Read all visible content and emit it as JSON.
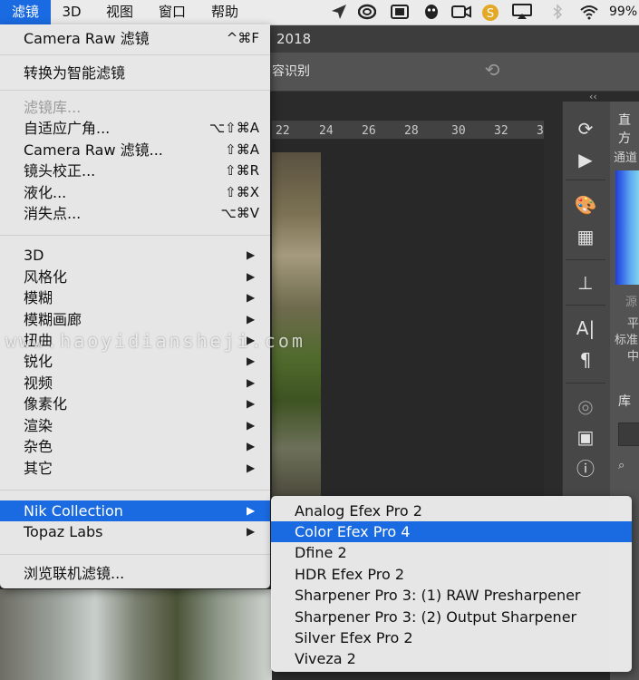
{
  "menubar": {
    "items": [
      {
        "label": "滤镜",
        "active": true
      },
      {
        "label": "3D"
      },
      {
        "label": "视图"
      },
      {
        "label": "窗口"
      },
      {
        "label": "帮助"
      }
    ],
    "status_icons": [
      "send-icon",
      "creative-cloud-icon",
      "screen-icon",
      "qq-icon",
      "camera-icon",
      "sketch-icon",
      "airplay-icon",
      "bluetooth-icon",
      "wifi-icon"
    ],
    "battery": "99%"
  },
  "photoshop": {
    "title": "2018",
    "content_aware": "容识别",
    "ruler_numbers": [
      "22",
      "24",
      "26",
      "28",
      "30",
      "32",
      "3"
    ],
    "panels": {
      "histogram_tab": "直方",
      "channel_label": "通道",
      "source_label": "源",
      "stats": [
        "平",
        "标准",
        "中"
      ],
      "library_tab": "库"
    }
  },
  "filter_menu": {
    "items": [
      {
        "label": "Camera Raw 滤镜",
        "shortcut": "^⌘F"
      },
      {
        "label": "转换为智能滤镜"
      },
      {
        "label": "滤镜库...",
        "disabled": true
      },
      {
        "label": "自适应广角...",
        "shortcut": "⌥⇧⌘A"
      },
      {
        "label": "Camera Raw 滤镜...",
        "shortcut": "⇧⌘A"
      },
      {
        "label": "镜头校正...",
        "shortcut": "⇧⌘R"
      },
      {
        "label": "液化...",
        "shortcut": "⇧⌘X"
      },
      {
        "label": "消失点...",
        "shortcut": "⌥⌘V"
      },
      {
        "label": "3D"
      },
      {
        "label": "风格化"
      },
      {
        "label": "模糊"
      },
      {
        "label": "模糊画廊"
      },
      {
        "label": "扭曲"
      },
      {
        "label": "锐化"
      },
      {
        "label": "视频"
      },
      {
        "label": "像素化"
      },
      {
        "label": "渲染"
      },
      {
        "label": "杂色"
      },
      {
        "label": "其它"
      },
      {
        "label": "Nik Collection",
        "highlighted": true
      },
      {
        "label": "Topaz Labs"
      },
      {
        "label": "浏览联机滤镜..."
      }
    ]
  },
  "nik_submenu": {
    "items": [
      {
        "label": "Analog Efex Pro 2"
      },
      {
        "label": "Color Efex Pro 4",
        "highlighted": true
      },
      {
        "label": "Dfine 2"
      },
      {
        "label": "HDR Efex Pro 2"
      },
      {
        "label": "Sharpener Pro 3: (1) RAW Presharpener"
      },
      {
        "label": "Sharpener Pro 3: (2) Output Sharpener"
      },
      {
        "label": "Silver Efex Pro 2"
      },
      {
        "label": "Viveza 2"
      }
    ]
  },
  "watermark": "www.haoyidiansheji.com",
  "colors": {
    "highlight": "#1a6ae1",
    "menu_bg": "#ececec"
  }
}
